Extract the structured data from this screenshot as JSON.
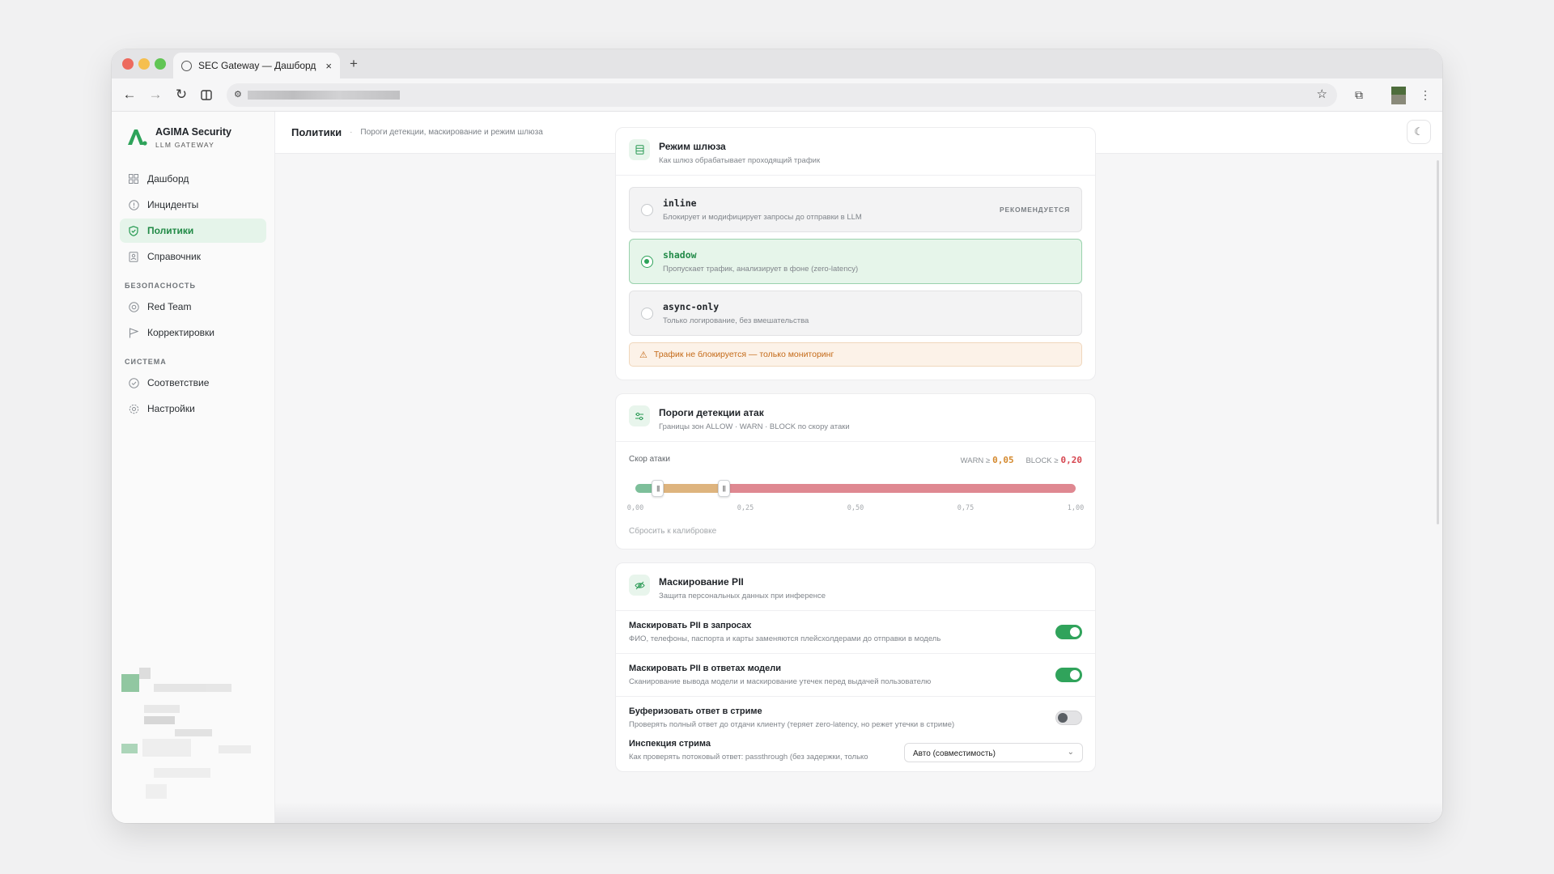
{
  "browser": {
    "tab_title": "SEC Gateway — Дашборд",
    "tab_close": "×",
    "new_tab": "+"
  },
  "sidebar": {
    "brand_name": "AGIMA Security",
    "brand_sub": "LLM GATEWAY",
    "items": [
      {
        "label": "Дашборд",
        "icon": "grid-icon"
      },
      {
        "label": "Инциденты",
        "icon": "alert-circle-icon"
      },
      {
        "label": "Политики",
        "icon": "shield-icon",
        "active": true
      },
      {
        "label": "Справочник",
        "icon": "book-icon"
      }
    ],
    "section_security": "БЕЗОПАСНОСТЬ",
    "security_items": [
      {
        "label": "Red Team",
        "icon": "target-icon"
      },
      {
        "label": "Корректировки",
        "icon": "flag-icon"
      }
    ],
    "section_system": "СИСТЕМА",
    "system_items": [
      {
        "label": "Соответствие",
        "icon": "check-circle-icon"
      },
      {
        "label": "Настройки",
        "icon": "gear-icon"
      }
    ]
  },
  "header": {
    "title": "Политики",
    "separator": "·",
    "subtitle": "Пороги детекции, маскирование и режим шлюза"
  },
  "gateway_mode": {
    "title": "Режим шлюза",
    "subtitle": "Как шлюз обрабатывает проходящий трафик",
    "options": [
      {
        "name": "inline",
        "desc": "Блокирует и модифицирует запросы до отправки в LLM",
        "badge": "РЕКОМЕНДУЕТСЯ",
        "selected": false
      },
      {
        "name": "shadow",
        "desc": "Пропускает трафик, анализирует в фоне (zero-latency)",
        "selected": true
      },
      {
        "name": "async-only",
        "desc": "Только логирование, без вмешательства",
        "selected": false
      }
    ],
    "warning": "Трафик не блокируется — только мониторинг"
  },
  "thresholds": {
    "title": "Пороги детекции атак",
    "subtitle": "Границы зон ALLOW · WARN · BLOCK по скору атаки",
    "score_label": "Скор атаки",
    "warn_label": "WARN ≥",
    "warn_value": "0,05",
    "block_label": "BLOCK ≥",
    "block_value": "0,20",
    "warn_fraction": 0.05,
    "block_fraction": 0.2,
    "ticks": [
      "0,00",
      "0,25",
      "0,50",
      "0,75",
      "1,00"
    ],
    "reset": "Сбросить к калибровке",
    "colors": {
      "allow": "#7dbf9a",
      "warn": "#deb47e",
      "block": "#df8891",
      "warn_text": "#d4892e",
      "block_text": "#d6454f"
    }
  },
  "pii": {
    "title": "Маскирование PII",
    "subtitle": "Защита персональных данных при инференсе",
    "rows": [
      {
        "title": "Маскировать PII в запросах",
        "desc": "ФИО, телефоны, паспорта и карты заменяются плейсхолдерами до отправки в модель",
        "on": true
      },
      {
        "title": "Маскировать PII в ответах модели",
        "desc": "Сканирование вывода модели и маскирование утечек перед выдачей пользователю",
        "on": true
      },
      {
        "title": "Буферизовать ответ в стриме",
        "desc": "Проверять полный ответ до отдачи клиенту (теряет zero-latency, но режет утечки в стриме)",
        "on": false
      }
    ],
    "stream_title": "Инспекция стрима",
    "stream_desc": "Как проверять потоковый ответ: passthrough (без задержки, только",
    "stream_select": "Авто (совместимость)"
  }
}
